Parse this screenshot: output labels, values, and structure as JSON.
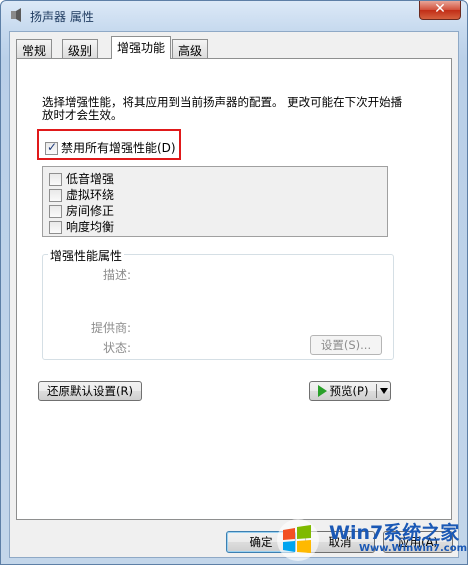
{
  "window": {
    "title": "扬声器 属性",
    "close_label": "✕"
  },
  "tabs": [
    {
      "label": "常规"
    },
    {
      "label": "级别"
    },
    {
      "label": "增强功能",
      "active": true
    },
    {
      "label": "高级"
    }
  ],
  "enhancements": {
    "description": "选择增强性能，将其应用到当前扬声器的配置。  更改可能在下次开始播放时才会生效。",
    "disable_all_label": "禁用所有增强性能(D)",
    "disable_all_checked": true,
    "effects": [
      {
        "label": "低音增强",
        "checked": false
      },
      {
        "label": "虚拟环绕",
        "checked": false
      },
      {
        "label": "房间修正",
        "checked": false
      },
      {
        "label": "响度均衡",
        "checked": false
      }
    ]
  },
  "properties": {
    "group_title": "增强性能属性",
    "description_label": "描述:",
    "provider_label": "提供商:",
    "status_label": "状态:",
    "settings_button": "设置(S)..."
  },
  "buttons": {
    "restore_defaults": "还原默认设置(R)",
    "preview": "预览(P)",
    "ok": "确定",
    "cancel": "取消",
    "apply": "应用(A)"
  },
  "watermark": {
    "brand": "Win7系统之家",
    "url": "Www.Winwin7.com"
  },
  "colors": {
    "highlight": "#e0191a",
    "play_icon": "#2aa02a"
  }
}
